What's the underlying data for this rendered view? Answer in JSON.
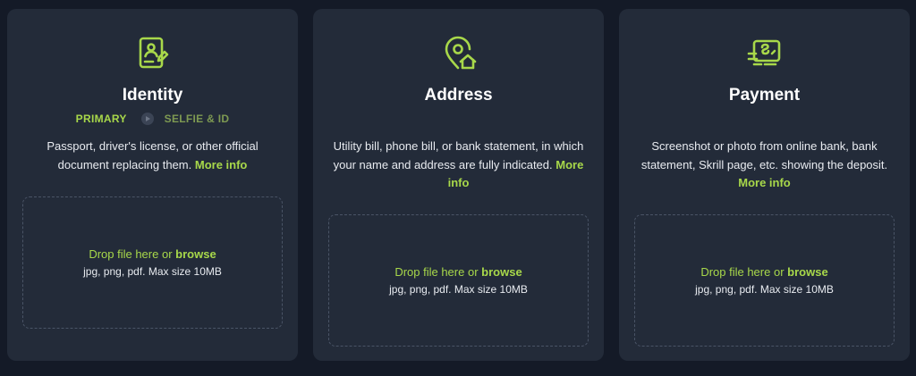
{
  "colors": {
    "accent": "#a8d84a",
    "card_bg": "#232b39",
    "page_bg": "#141a27"
  },
  "cards": [
    {
      "icon": "identity-document-icon",
      "title": "Identity",
      "steps": {
        "primary": "PRIMARY",
        "secondary": "SELFIE & ID"
      },
      "description": "Passport, driver's license, or other official document replacing them.",
      "more": "More info",
      "drop": {
        "text": "Drop file here or",
        "browse": "browse",
        "hint": "jpg, png, pdf. Max size 10MB"
      }
    },
    {
      "icon": "location-home-icon",
      "title": "Address",
      "description": "Utility bill, phone bill, or bank statement, in which your name and address are fully indicated.",
      "more": "More info",
      "drop": {
        "text": "Drop file here or",
        "browse": "browse",
        "hint": "jpg, png, pdf. Max size 10MB"
      }
    },
    {
      "icon": "payment-card-icon",
      "title": "Payment",
      "description": "Screenshot or photo from online bank, bank statement, Skrill page, etc. showing the deposit.",
      "more": "More info",
      "drop": {
        "text": "Drop file here or",
        "browse": "browse",
        "hint": "jpg, png, pdf. Max size 10MB"
      }
    }
  ]
}
